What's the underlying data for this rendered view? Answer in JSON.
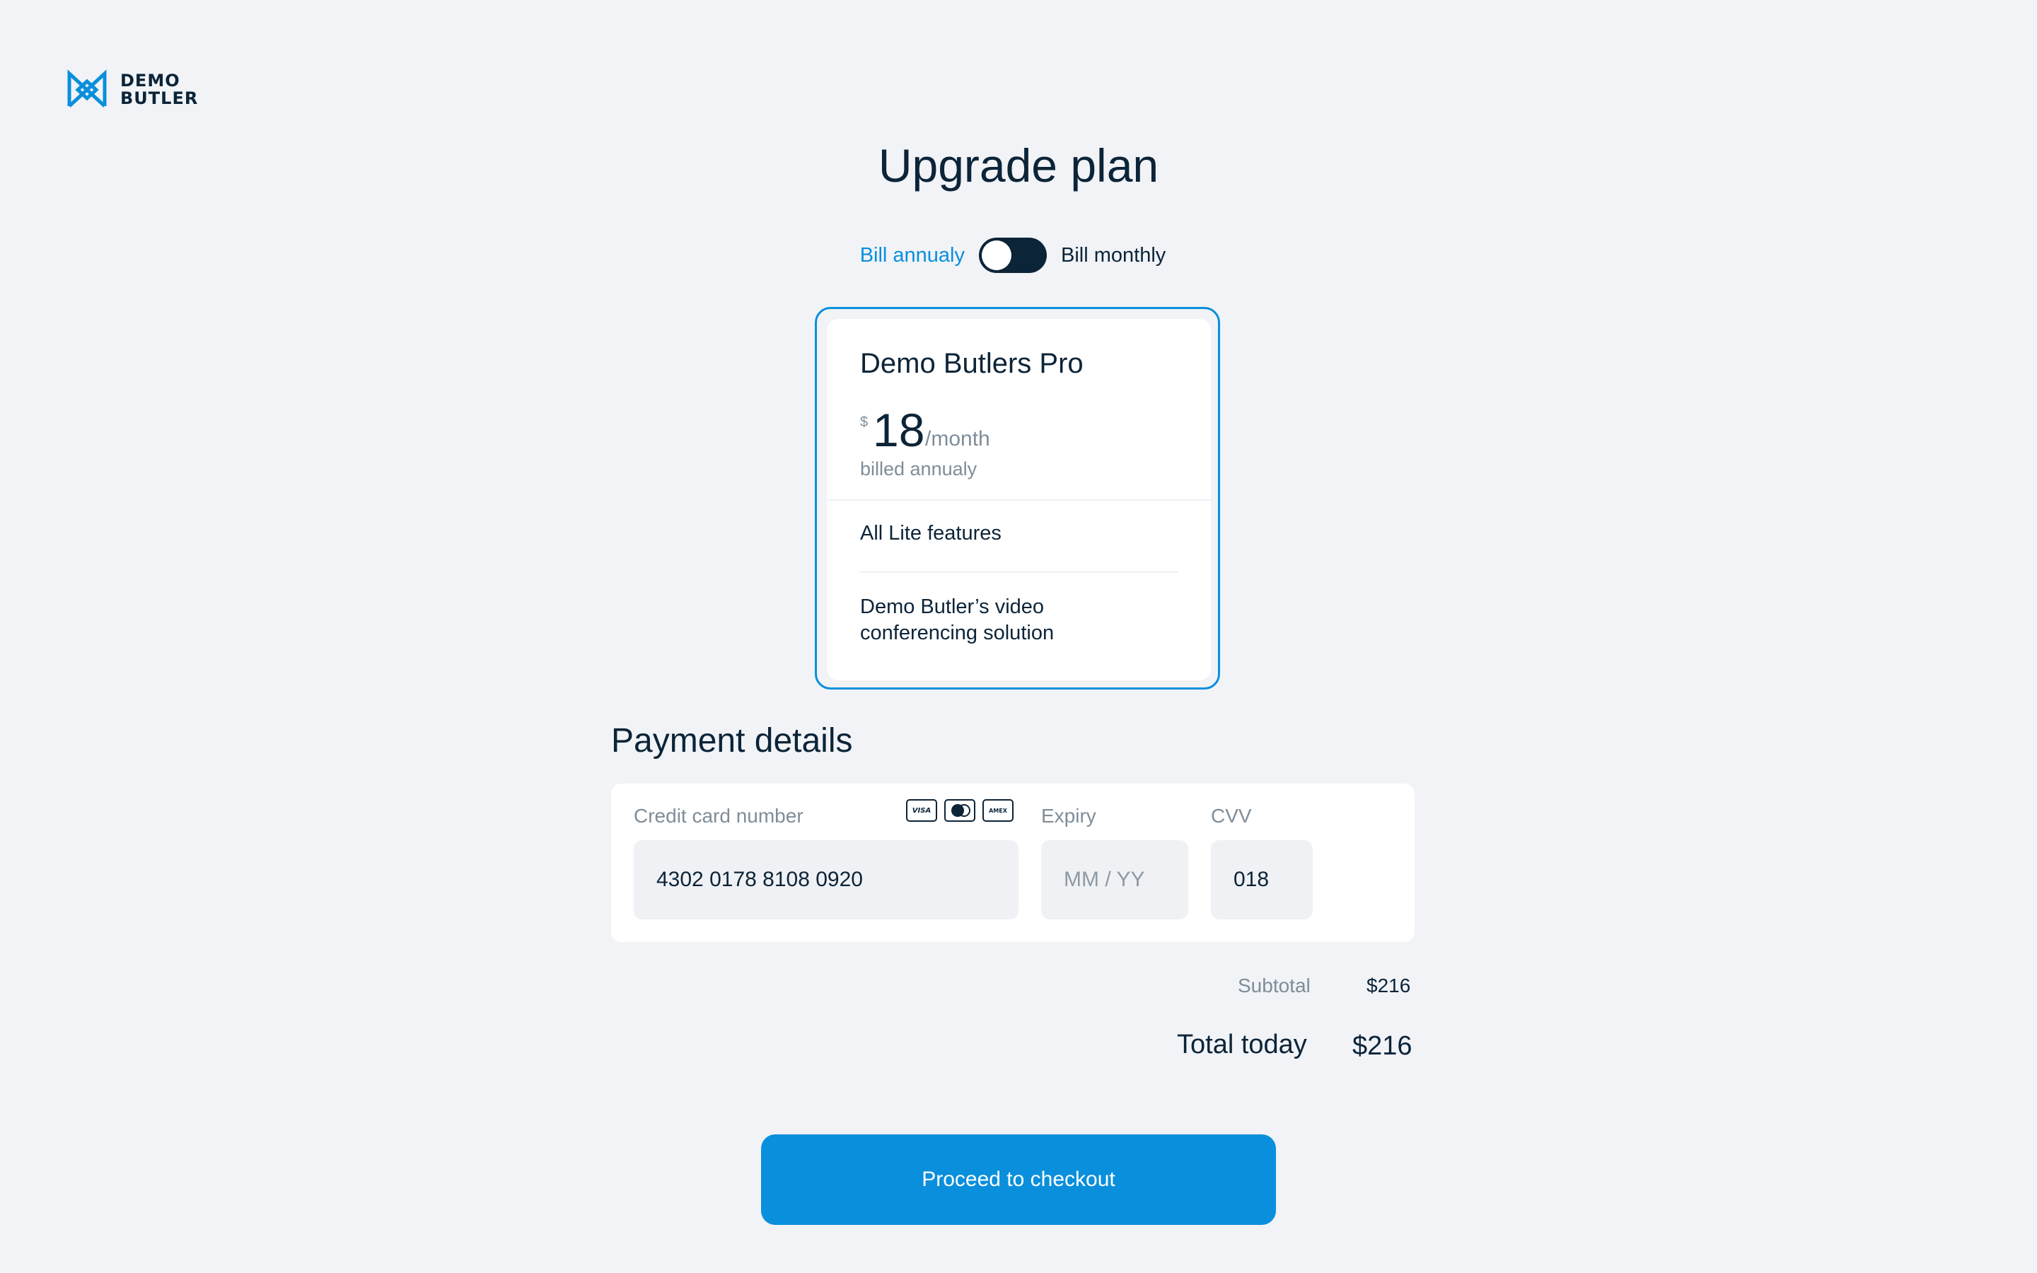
{
  "brand": {
    "line1": "DEMO",
    "line2": "BUTLER",
    "color": "#0a8fdc"
  },
  "page_title": "Upgrade plan",
  "billing_toggle": {
    "left_label": "Bill annualy",
    "right_label": "Bill monthly",
    "selected": "annual"
  },
  "plan": {
    "name": "Demo Butlers Pro",
    "currency_symbol": "$",
    "price": "18",
    "period": "/month",
    "billing_note": "billed annualy",
    "features": [
      "All Lite features",
      "Demo Butler’s video conferencing solution"
    ]
  },
  "payment": {
    "title": "Payment details",
    "card_number_label": "Credit card number",
    "card_number_value": "4302 0178 8108 0920",
    "card_brands": [
      "VISA",
      "mastercard",
      "AMEX"
    ],
    "expiry_label": "Expiry",
    "expiry_placeholder": "MM / YY",
    "cvv_label": "CVV",
    "cvv_value": "018"
  },
  "totals": {
    "subtotal_label": "Subtotal",
    "subtotal_value": "$216",
    "total_label": "Total today",
    "total_value": "$216"
  },
  "checkout_button": "Proceed to checkout",
  "colors": {
    "accent": "#0a8fdc",
    "dark": "#0c2438",
    "muted": "#7f8d99",
    "background": "#f1f3f7"
  }
}
